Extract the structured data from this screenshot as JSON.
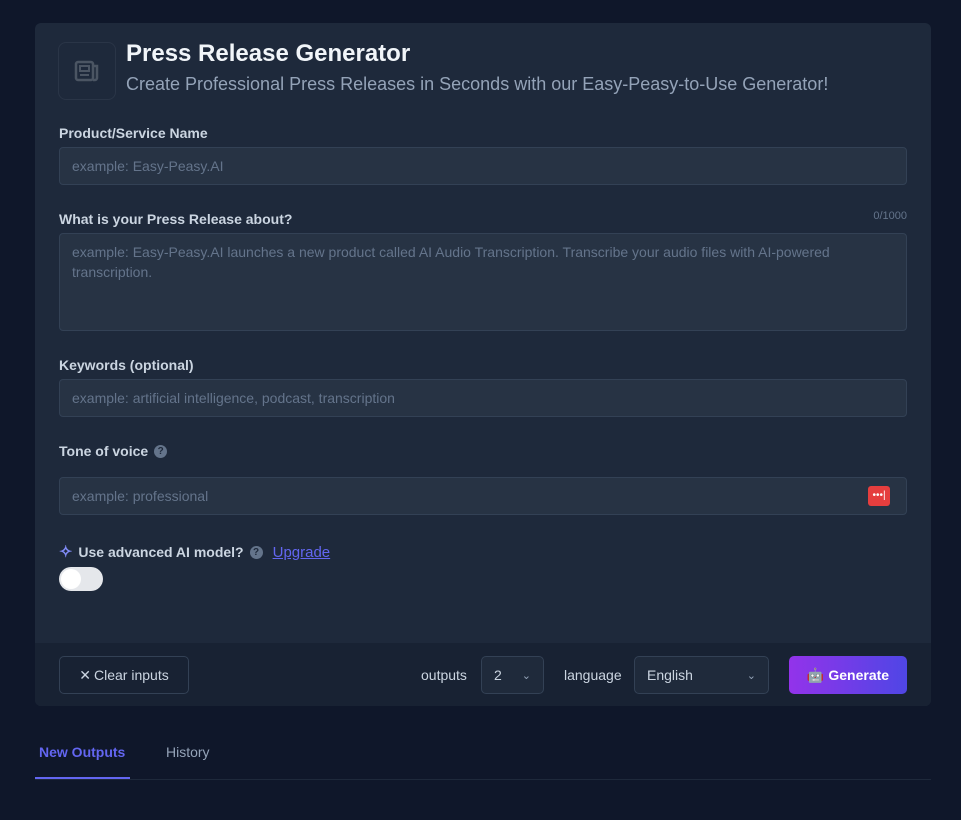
{
  "header": {
    "title": "Press Release Generator",
    "subtitle": "Create Professional Press Releases in Seconds with our Easy-Peasy-to-Use Generator!"
  },
  "fields": {
    "name": {
      "label": "Product/Service Name",
      "placeholder": "example: Easy-Peasy.AI"
    },
    "about": {
      "label": "What is your Press Release about?",
      "counter": "0/1000",
      "placeholder": "example: Easy-Peasy.AI launches a new product called AI Audio Transcription. Transcribe your audio files with AI-powered transcription."
    },
    "keywords": {
      "label": "Keywords (optional)",
      "placeholder": "example: artificial intelligence, podcast, transcription"
    },
    "tone": {
      "label": "Tone of voice",
      "placeholder": "example: professional"
    }
  },
  "advanced": {
    "label": "Use advanced AI model?",
    "upgrade": "Upgrade",
    "enabled": false
  },
  "footer": {
    "clear": "Clear inputs",
    "outputs_label": "outputs",
    "outputs_value": "2",
    "language_label": "language",
    "language_value": "English",
    "generate": "Generate"
  },
  "tabs": [
    "New Outputs",
    "History"
  ]
}
